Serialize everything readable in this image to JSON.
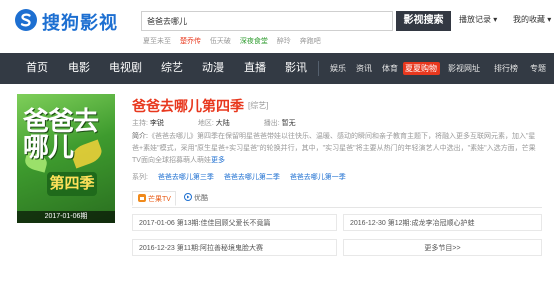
{
  "header": {
    "logo_text": "搜狗影视",
    "search_value": "爸爸去哪儿",
    "search_button": "影视搜索",
    "play_history": "播放记录 ▾",
    "my_favorites": "我的收藏 ▾",
    "hot_words": [
      {
        "text": "夏至未至",
        "color": "gray"
      },
      {
        "text": "楚乔传",
        "color": "red"
      },
      {
        "text": "伍天破",
        "color": "gray"
      },
      {
        "text": "深夜食堂",
        "color": "green"
      },
      {
        "text": "醉玲",
        "color": "gray"
      },
      {
        "text": "奔跑吧",
        "color": "gray"
      }
    ]
  },
  "nav": {
    "main": [
      "首页",
      "电影",
      "电视剧",
      "综艺",
      "动漫",
      "直播",
      "影讯"
    ],
    "sub": [
      "娱乐",
      "资讯",
      "体育",
      "夏夏购物",
      "影视网址",
      "排行榜",
      "专题"
    ]
  },
  "poster": {
    "title": "爸爸去哪儿",
    "season": "第四季",
    "date": "2017-01-06期"
  },
  "show": {
    "title": "爸爸去哪儿",
    "season": "第四季",
    "genre": "[综艺]",
    "host_label": "主持:",
    "host": "李锐",
    "region_label": "地区:",
    "region": "大陆",
    "date_label": "播出:",
    "date": "暂无",
    "intro_label": "简介:",
    "intro": "《爸爸去哪儿》第四季在保留明星爸爸带娃以往快乐、温暖、感动的瞬间和亲子教育主题下，将融入更多互联网元素，加入\"星爸+素娃\"模式，采用\"原生星爸+实习星爸\"的轮换并行，其中，\"实习星爸\"将主要从热门的年轻演艺人中选出，\"素娃\"入选方面，芒果TV面向全球招募萌人萌娃",
    "more": "更多",
    "series_label": "系列:",
    "series": [
      "爸爸去哪儿第三季",
      "爸爸去哪儿第二季",
      "爸爸去哪儿第一季"
    ]
  },
  "sources": {
    "tabs": [
      "芒果TV",
      "优酷"
    ]
  },
  "episodes": [
    "2017-01-06 第13期:佳佳回顾父爱长不竟篇",
    "2016-12-30 第12期:成龙李冶冠顺心护蛙",
    "2016-12-23 第11期:阿拉善秘境鬼脸大赛",
    "更多节目>>"
  ],
  "colors": {
    "accent_red": "#e8381e",
    "brand_blue": "#1d6fd1",
    "nav_bg": "#333a44"
  }
}
